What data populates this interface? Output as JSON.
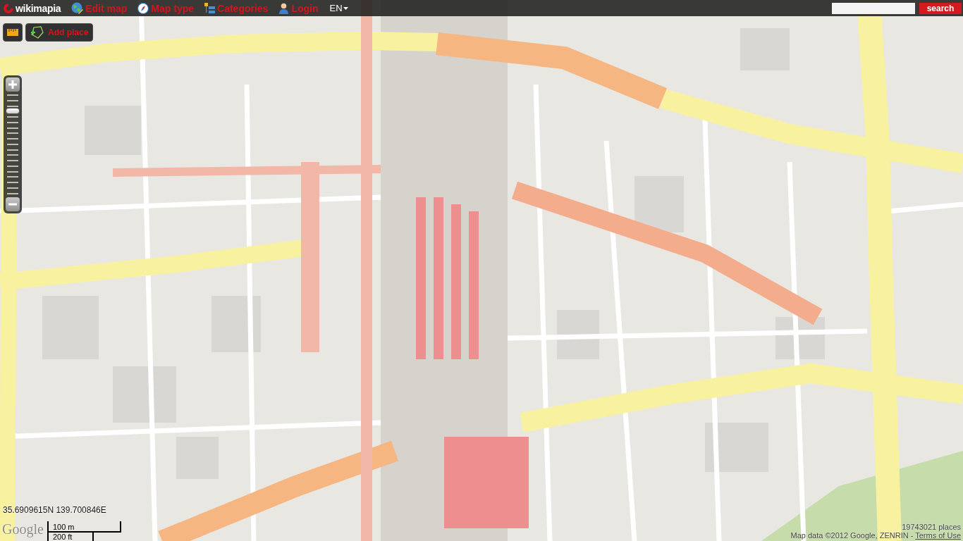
{
  "toolbar": {
    "logo": "wikimapia",
    "menu": [
      {
        "kind": "edit",
        "label": "Edit map"
      },
      {
        "kind": "map_type",
        "label": "Map type"
      },
      {
        "kind": "categories",
        "label": "Categories"
      },
      {
        "kind": "login",
        "label": "Login"
      }
    ],
    "language": "EN",
    "search": {
      "button": "search"
    }
  },
  "tools": {
    "add_place": "Add place"
  },
  "zoom": {
    "level": 0.85
  },
  "map": {
    "coordinates": "35.6909615N 139.700846E",
    "logo": "Google",
    "scale": [
      "100 m",
      "200 ft"
    ],
    "places_count": "19743021 places",
    "attribution": "Map data ©2012 Google, ZENRIN - ",
    "terms_link": "Terms of Use"
  }
}
